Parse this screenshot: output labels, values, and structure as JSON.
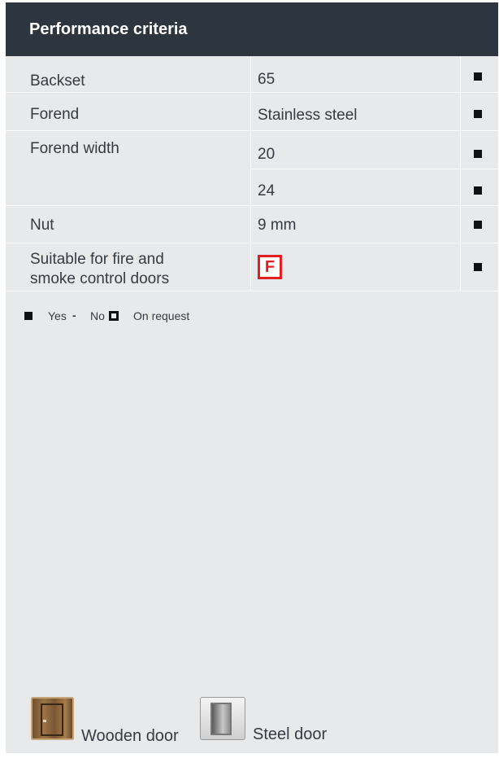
{
  "header": {
    "title": "Performance criteria"
  },
  "rows": [
    {
      "label": "Backset",
      "value": "65"
    },
    {
      "label": "Forend",
      "value": "Stainless steel"
    },
    {
      "label": "Forend width",
      "value": "20"
    },
    {
      "label": "",
      "value": "24"
    },
    {
      "label": "Nut",
      "value": "9 mm"
    },
    {
      "label_line1": "Suitable for fire and",
      "label_line2": "smoke control doors",
      "value_icon": "fire-rated-F-icon",
      "value_icon_text": "F"
    }
  ],
  "legend": {
    "yes": "Yes",
    "no": "No",
    "on_request": "On request",
    "dash": "-"
  },
  "doors": {
    "wooden": "Wooden door",
    "steel": "Steel door"
  },
  "colors": {
    "header_bg": "#2d353e",
    "panel_bg": "#e8e9ea",
    "fire_red": "#e31e24"
  }
}
